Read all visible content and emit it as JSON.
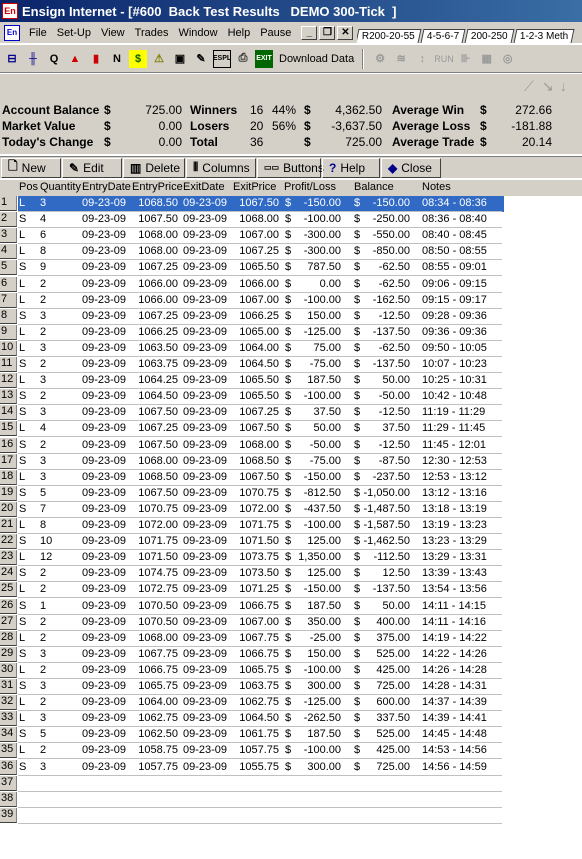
{
  "window": {
    "title": "Ensign Internet - [#600  Back Test Results   DEMO 300-Tick  ]",
    "app_icon": "En",
    "doc_icon": "En"
  },
  "menu": [
    "File",
    "Set-Up",
    "View",
    "Trades",
    "Window",
    "Help",
    "Pause"
  ],
  "tabs": [
    "R200-20-55",
    "4-5-6-7",
    "200-250",
    "1-2-3 Meth"
  ],
  "toolbar": {
    "download_label": "Download Data",
    "run_label": "RUN"
  },
  "summary": {
    "account_balance_label": "Account Balance",
    "account_balance_value": "725.00",
    "market_value_label": "Market Value",
    "market_value_value": "0.00",
    "todays_change_label": "Today's Change",
    "todays_change_value": "0.00",
    "currency": "$",
    "winners_label": "Winners",
    "winners_count": "16",
    "winners_pct": "44%",
    "winners_amount": "4,362.50",
    "losers_label": "Losers",
    "losers_count": "20",
    "losers_pct": "56%",
    "losers_amount": "-3,637.50",
    "total_label": "Total",
    "total_count": "36",
    "total_amount": "725.00",
    "avg_win_label": "Average Win",
    "avg_win_value": "272.66",
    "avg_loss_label": "Average Loss",
    "avg_loss_value": "-181.88",
    "avg_trade_label": "Average Trade",
    "avg_trade_value": "20.14"
  },
  "actions": {
    "new": "New",
    "edit": "Edit",
    "delete": "Delete",
    "columns": "Columns",
    "buttons": "Buttons",
    "help": "Help",
    "close": "Close"
  },
  "columns": [
    "Pos",
    "Quantity",
    "EntryDate",
    "EntryPrice",
    "ExitDate",
    "ExitPrice",
    "Profit/Loss",
    "Balance",
    "Notes"
  ],
  "trades": [
    [
      "1",
      "L",
      "3",
      "09-23-09",
      "1068.50",
      "09-23-09",
      "1067.50",
      "$",
      "-150.00",
      "$",
      "-150.00",
      "08:34 - 08:36"
    ],
    [
      "2",
      "S",
      "4",
      "09-23-09",
      "1067.50",
      "09-23-09",
      "1068.00",
      "$",
      "-100.00",
      "$",
      "-250.00",
      "08:36 - 08:40"
    ],
    [
      "3",
      "L",
      "6",
      "09-23-09",
      "1068.00",
      "09-23-09",
      "1067.00",
      "$",
      "-300.00",
      "$",
      "-550.00",
      "08:40 - 08:45"
    ],
    [
      "4",
      "L",
      "8",
      "09-23-09",
      "1068.00",
      "09-23-09",
      "1067.25",
      "$",
      "-300.00",
      "$",
      "-850.00",
      "08:50 - 08:55"
    ],
    [
      "5",
      "S",
      "9",
      "09-23-09",
      "1067.25",
      "09-23-09",
      "1065.50",
      "$",
      "787.50",
      "$",
      "-62.50",
      "08:55 - 09:01"
    ],
    [
      "6",
      "L",
      "2",
      "09-23-09",
      "1066.00",
      "09-23-09",
      "1066.00",
      "$",
      "0.00",
      "$",
      "-62.50",
      "09:06 - 09:15"
    ],
    [
      "7",
      "L",
      "2",
      "09-23-09",
      "1066.00",
      "09-23-09",
      "1067.00",
      "$",
      "-100.00",
      "$",
      "-162.50",
      "09:15 - 09:17"
    ],
    [
      "8",
      "S",
      "3",
      "09-23-09",
      "1067.25",
      "09-23-09",
      "1066.25",
      "$",
      "150.00",
      "$",
      "-12.50",
      "09:28 - 09:36"
    ],
    [
      "9",
      "L",
      "2",
      "09-23-09",
      "1066.25",
      "09-23-09",
      "1065.00",
      "$",
      "-125.00",
      "$",
      "-137.50",
      "09:36 - 09:36"
    ],
    [
      "10",
      "L",
      "3",
      "09-23-09",
      "1063.50",
      "09-23-09",
      "1064.00",
      "$",
      "75.00",
      "$",
      "-62.50",
      "09:50 - 10:05"
    ],
    [
      "11",
      "S",
      "2",
      "09-23-09",
      "1063.75",
      "09-23-09",
      "1064.50",
      "$",
      "-75.00",
      "$",
      "-137.50",
      "10:07 - 10:23"
    ],
    [
      "12",
      "L",
      "3",
      "09-23-09",
      "1064.25",
      "09-23-09",
      "1065.50",
      "$",
      "187.50",
      "$",
      "50.00",
      "10:25 - 10:31"
    ],
    [
      "13",
      "S",
      "2",
      "09-23-09",
      "1064.50",
      "09-23-09",
      "1065.50",
      "$",
      "-100.00",
      "$",
      "-50.00",
      "10:42 - 10:48"
    ],
    [
      "14",
      "S",
      "3",
      "09-23-09",
      "1067.50",
      "09-23-09",
      "1067.25",
      "$",
      "37.50",
      "$",
      "-12.50",
      "11:19 - 11:29"
    ],
    [
      "15",
      "L",
      "4",
      "09-23-09",
      "1067.25",
      "09-23-09",
      "1067.50",
      "$",
      "50.00",
      "$",
      "37.50",
      "11:29 - 11:45"
    ],
    [
      "16",
      "S",
      "2",
      "09-23-09",
      "1067.50",
      "09-23-09",
      "1068.00",
      "$",
      "-50.00",
      "$",
      "-12.50",
      "11:45 - 12:01"
    ],
    [
      "17",
      "S",
      "3",
      "09-23-09",
      "1068.00",
      "09-23-09",
      "1068.50",
      "$",
      "-75.00",
      "$",
      "-87.50",
      "12:30 - 12:53"
    ],
    [
      "18",
      "L",
      "3",
      "09-23-09",
      "1068.50",
      "09-23-09",
      "1067.50",
      "$",
      "-150.00",
      "$",
      "-237.50",
      "12:53 - 13:12"
    ],
    [
      "19",
      "S",
      "5",
      "09-23-09",
      "1067.50",
      "09-23-09",
      "1070.75",
      "$",
      "-812.50",
      "$",
      "-1,050.00",
      "13:12 - 13:16"
    ],
    [
      "20",
      "S",
      "7",
      "09-23-09",
      "1070.75",
      "09-23-09",
      "1072.00",
      "$",
      "-437.50",
      "$",
      "-1,487.50",
      "13:18 - 13:19"
    ],
    [
      "21",
      "L",
      "8",
      "09-23-09",
      "1072.00",
      "09-23-09",
      "1071.75",
      "$",
      "-100.00",
      "$",
      "-1,587.50",
      "13:19 - 13:23"
    ],
    [
      "22",
      "S",
      "10",
      "09-23-09",
      "1071.75",
      "09-23-09",
      "1071.50",
      "$",
      "125.00",
      "$",
      "-1,462.50",
      "13:23 - 13:29"
    ],
    [
      "23",
      "L",
      "12",
      "09-23-09",
      "1071.50",
      "09-23-09",
      "1073.75",
      "$",
      "1,350.00",
      "$",
      "-112.50",
      "13:29 - 13:31"
    ],
    [
      "24",
      "S",
      "2",
      "09-23-09",
      "1074.75",
      "09-23-09",
      "1073.50",
      "$",
      "125.00",
      "$",
      "12.50",
      "13:39 - 13:43"
    ],
    [
      "25",
      "L",
      "2",
      "09-23-09",
      "1072.75",
      "09-23-09",
      "1071.25",
      "$",
      "-150.00",
      "$",
      "-137.50",
      "13:54 - 13:56"
    ],
    [
      "26",
      "S",
      "1",
      "09-23-09",
      "1070.50",
      "09-23-09",
      "1066.75",
      "$",
      "187.50",
      "$",
      "50.00",
      "14:11 - 14:15"
    ],
    [
      "27",
      "S",
      "2",
      "09-23-09",
      "1070.50",
      "09-23-09",
      "1067.00",
      "$",
      "350.00",
      "$",
      "400.00",
      "14:11 - 14:16"
    ],
    [
      "28",
      "L",
      "2",
      "09-23-09",
      "1068.00",
      "09-23-09",
      "1067.75",
      "$",
      "-25.00",
      "$",
      "375.00",
      "14:19 - 14:22"
    ],
    [
      "29",
      "S",
      "3",
      "09-23-09",
      "1067.75",
      "09-23-09",
      "1066.75",
      "$",
      "150.00",
      "$",
      "525.00",
      "14:22 - 14:26"
    ],
    [
      "30",
      "L",
      "2",
      "09-23-09",
      "1066.75",
      "09-23-09",
      "1065.75",
      "$",
      "-100.00",
      "$",
      "425.00",
      "14:26 - 14:28"
    ],
    [
      "31",
      "S",
      "3",
      "09-23-09",
      "1065.75",
      "09-23-09",
      "1063.75",
      "$",
      "300.00",
      "$",
      "725.00",
      "14:28 - 14:31"
    ],
    [
      "32",
      "L",
      "2",
      "09-23-09",
      "1064.00",
      "09-23-09",
      "1062.75",
      "$",
      "-125.00",
      "$",
      "600.00",
      "14:37 - 14:39"
    ],
    [
      "33",
      "L",
      "3",
      "09-23-09",
      "1062.75",
      "09-23-09",
      "1064.50",
      "$",
      "-262.50",
      "$",
      "337.50",
      "14:39 - 14:41"
    ],
    [
      "34",
      "S",
      "5",
      "09-23-09",
      "1062.50",
      "09-23-09",
      "1061.75",
      "$",
      "187.50",
      "$",
      "525.00",
      "14:45 - 14:48"
    ],
    [
      "35",
      "L",
      "2",
      "09-23-09",
      "1058.75",
      "09-23-09",
      "1057.75",
      "$",
      "-100.00",
      "$",
      "425.00",
      "14:53 - 14:56"
    ],
    [
      "36",
      "S",
      "3",
      "09-23-09",
      "1057.75",
      "09-23-09",
      "1055.75",
      "$",
      "300.00",
      "$",
      "725.00",
      "14:56 - 14:59"
    ]
  ],
  "empty_rows": [
    "37",
    "38",
    "39"
  ],
  "selected_row": 0,
  "colors": {
    "title_bar": "#0a246a",
    "selection": "#316ac5",
    "chrome": "#d4d0c8"
  }
}
